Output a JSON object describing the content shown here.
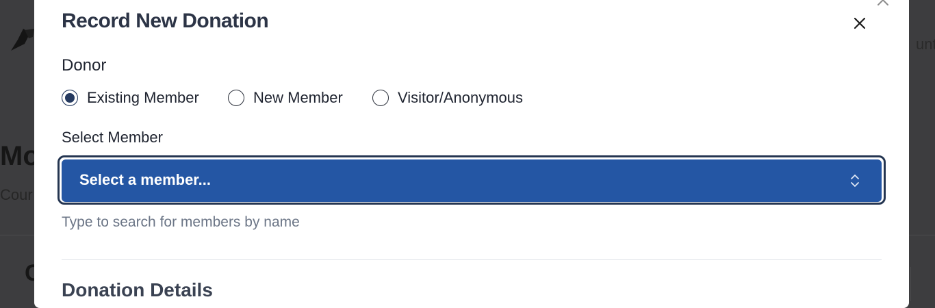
{
  "background": {
    "top_right_text": "unt",
    "heading_fragment": "Mo",
    "subheading_fragment": "Cour",
    "section_fragment": "C"
  },
  "modal": {
    "title": "Record New Donation",
    "close_label": "×",
    "donor": {
      "label": "Donor",
      "options": [
        {
          "label": "Existing Member",
          "checked": true
        },
        {
          "label": "New Member",
          "checked": false
        },
        {
          "label": "Visitor/Anonymous",
          "checked": false
        }
      ]
    },
    "select_member": {
      "label": "Select Member",
      "value": "Select a member...",
      "help": "Type to search for members by name"
    },
    "donation_details_title": "Donation Details"
  },
  "colors": {
    "select_bg": "#2456a4",
    "radio_checked": "#253a60",
    "overlay": "#3d3d3f"
  }
}
